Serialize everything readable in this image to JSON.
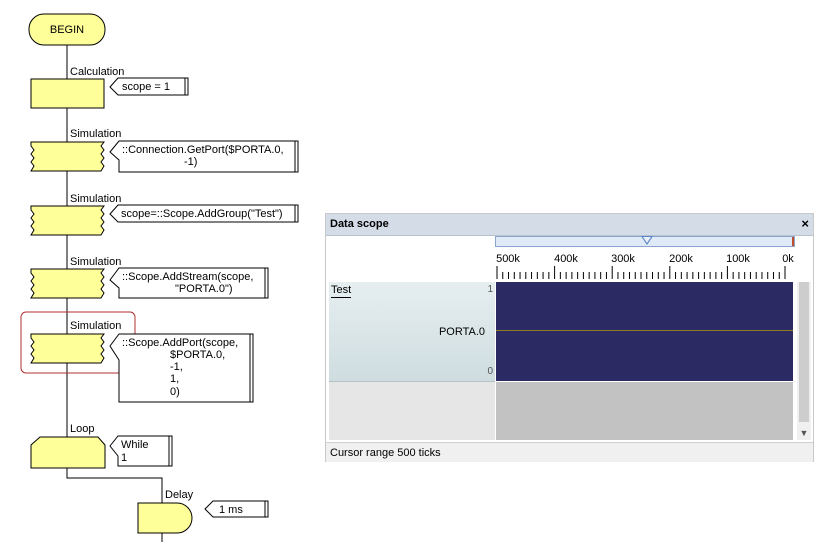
{
  "flowchart": {
    "begin_label": "BEGIN",
    "blocks": [
      {
        "caption": "Calculation",
        "comment_lines": [
          "scope = 1"
        ]
      },
      {
        "caption": "Simulation",
        "comment_lines": [
          "::Connection.GetPort($PORTA.0,",
          "-1)"
        ]
      },
      {
        "caption": "Simulation",
        "comment_lines": [
          "scope=::Scope.AddGroup(\"Test\")"
        ]
      },
      {
        "caption": "Simulation",
        "comment_lines": [
          "::Scope.AddStream(scope,",
          "\"PORTA.0\")"
        ]
      },
      {
        "caption": "Simulation",
        "comment_lines": [
          "::Scope.AddPort(scope,",
          "$PORTA.0,",
          "-1,",
          "1,",
          "0)"
        ]
      }
    ],
    "loop": {
      "caption": "Loop",
      "comment_lines": [
        "While",
        "1"
      ]
    },
    "delay": {
      "caption": "Delay",
      "comment_lines": [
        "1 ms"
      ]
    },
    "colors": {
      "block_fill": "#ffff99",
      "selection": "#b03030"
    }
  },
  "data_scope": {
    "title": "Data scope",
    "close_icon": "×",
    "time_ticks": [
      "500k",
      "400k",
      "300k",
      "200k",
      "100k",
      "0k"
    ],
    "group_name": "Test",
    "stream_name": "PORTA.0",
    "y_max_label": "1",
    "y_min_label": "0",
    "status": "Cursor range 500 ticks",
    "colors": {
      "plot_bg": "#2b2a62",
      "trace": "#8f7a2a",
      "titlebar": "#d4dce8"
    }
  }
}
